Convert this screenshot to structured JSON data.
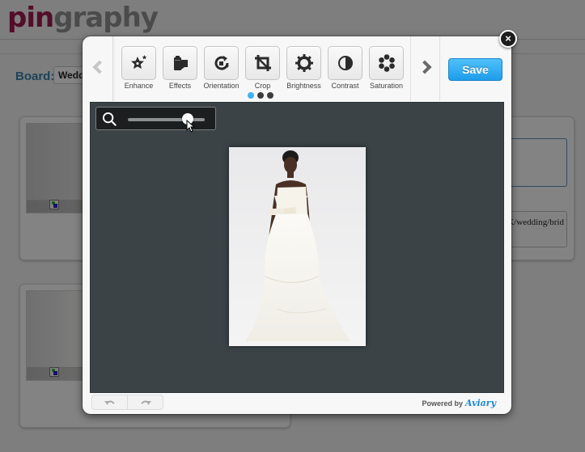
{
  "page": {
    "logo": {
      "prefix": "pin",
      "suffix": "graphy"
    },
    "board": {
      "label": "Board:",
      "selected": "Wedding"
    },
    "pin_form": {
      "url_value": "K/wedding/brid"
    }
  },
  "editor": {
    "tools": [
      {
        "id": "enhance",
        "label": "Enhance",
        "icon": "star-sparkle-icon"
      },
      {
        "id": "effects",
        "label": "Effects",
        "icon": "film-roll-icon"
      },
      {
        "id": "orientation",
        "label": "Orientation",
        "icon": "rotate-icon"
      },
      {
        "id": "crop",
        "label": "Crop",
        "icon": "crop-icon"
      },
      {
        "id": "brightness",
        "label": "Brightness",
        "icon": "sun-gear-icon"
      },
      {
        "id": "contrast",
        "label": "Contrast",
        "icon": "half-circle-icon"
      },
      {
        "id": "saturation",
        "label": "Saturation",
        "icon": "flower-dots-icon"
      }
    ],
    "pager": {
      "pages": 3,
      "active": 1
    },
    "save_label": "Save",
    "close_label": "×",
    "zoom": {
      "level_fraction": 0.78
    },
    "footer": {
      "powered_by": "Powered by",
      "brand": "Aviary"
    },
    "colors": {
      "accent": "#1e9de9",
      "canvas": "#3b4347",
      "active_dot": "#3fb2f2",
      "logo_pin": "#9c1a4e"
    }
  }
}
